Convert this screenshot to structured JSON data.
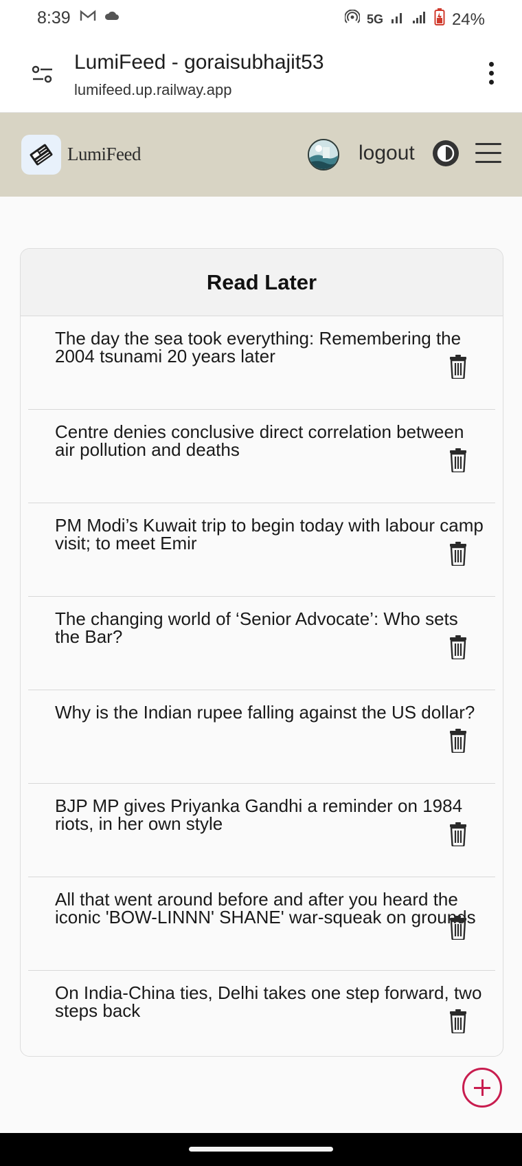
{
  "status_bar": {
    "time": "8:39",
    "network": "5G",
    "battery": "24%",
    "icons": [
      "gmail-icon",
      "cloud-icon",
      "hotspot-icon",
      "signal-icon",
      "signal-icon",
      "battery-charging-icon"
    ]
  },
  "browser": {
    "title": "LumiFeed - goraisubhajit53",
    "url": "lumifeed.up.railway.app"
  },
  "app_header": {
    "brand": "LumiFeed",
    "logout_label": "logout",
    "icons": [
      "newspaper-logo-icon",
      "avatar",
      "theme-toggle-icon",
      "menu-icon"
    ]
  },
  "read_later": {
    "title": "Read Later",
    "items": [
      {
        "title": "The day the sea took everything: Remembering the 2004 tsunami 20 years later"
      },
      {
        "title": "Centre denies conclusive direct correlation between air pollution and deaths"
      },
      {
        "title": "PM Modi’s Kuwait trip to begin today with labour camp visit; to meet Emir"
      },
      {
        "title": "The changing world of ‘Senior Advocate’: Who sets the Bar?"
      },
      {
        "title": "Why is the Indian rupee falling against the US dollar?"
      },
      {
        "title": "BJP MP gives Priyanka Gandhi a reminder on 1984 riots, in her own style"
      },
      {
        "title": "All that went around before and after you heard the iconic 'BOW-LINNN' SHANE' war-squeak on grounds"
      },
      {
        "title": "On India-China ties, Delhi takes one step forward, two steps back"
      }
    ]
  },
  "colors": {
    "header_bg": "#d8d4c4",
    "fab_accent": "#c81d4f",
    "page_bg": "#fafafa"
  }
}
